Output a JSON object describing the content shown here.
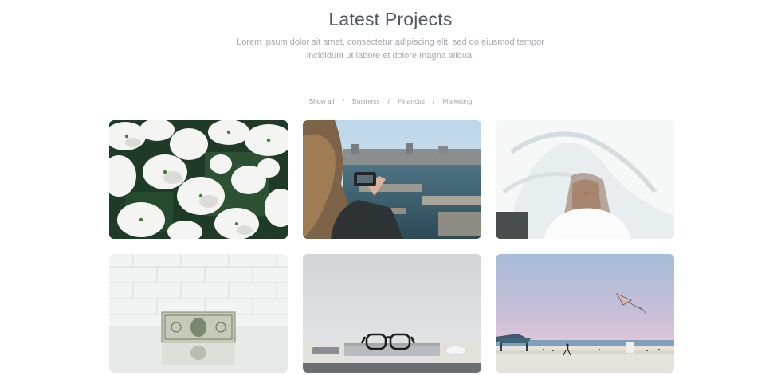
{
  "section": {
    "title": "Latest Projects",
    "description_line1": "Lorem ipsum dolor sit amet, consectetur adipiscing elit, sed do eiusmod tempor",
    "description_line2": "incididunt ut labore et dolore magna aliqua."
  },
  "filters": {
    "items": [
      "Show all",
      "Business",
      "Financial",
      "Marketing"
    ],
    "separator": "/",
    "active": "Show all"
  },
  "projects": [
    {
      "subject": "white flowers"
    },
    {
      "subject": "person photographing harbor"
    },
    {
      "subject": "woman under white fabric"
    },
    {
      "subject": "dollar bill on white brick"
    },
    {
      "subject": "glasses on laptop"
    },
    {
      "subject": "beach with kite"
    }
  ]
}
